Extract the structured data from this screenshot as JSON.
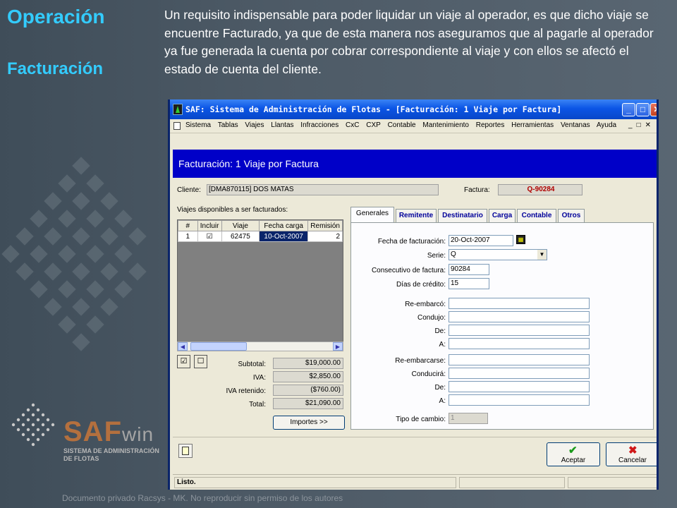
{
  "slide": {
    "title": "Operación",
    "subtitle": "Facturación",
    "body": "Un requisito indispensable para poder liquidar un viaje al operador, es que dicho viaje se encuentre Facturado, ya que de esta manera nos aseguramos que al pagarle al operador ya fue generada la cuenta por cobrar correspondiente al viaje y con ellos se afectó el estado de cuenta del cliente.",
    "logo_brand": "SAF",
    "logo_suffix": "win",
    "logo_tagline": "SISTEMA DE ADMINISTRACIÓN DE FLOTAS",
    "footer": "Documento privado Racsys - MK. No reproducir sin permiso de los autores"
  },
  "window": {
    "title": "SAF: Sistema de Administración de Flotas - [Facturación: 1 Viaje por Factura]",
    "menu": [
      "Sistema",
      "Tablas",
      "Viajes",
      "Llantas",
      "Infracciones",
      "CxC",
      "CXP",
      "Contable",
      "Mantenimiento",
      "Reportes",
      "Herramientas",
      "Ventanas",
      "Ayuda"
    ],
    "form_header": "Facturación: 1 Viaje por Factura",
    "cliente_label": "Cliente:",
    "cliente_value": "[DMA870115] DOS MATAS",
    "factura_label": "Factura:",
    "factura_value": "Q-90284",
    "viajes_label": "Viajes disponibles a ser facturados:",
    "grid": {
      "headers": [
        "#",
        "Incluir",
        "Viaje",
        "Fecha carga",
        "Remisión"
      ],
      "rows": [
        {
          "num": "1",
          "incluir": "☑",
          "viaje": "62475",
          "fecha": "10-Oct-2007",
          "remision": "2"
        }
      ]
    },
    "totals": {
      "subtotal_label": "Subtotal:",
      "subtotal": "$19,000.00",
      "iva_label": "IVA:",
      "iva": "$2,850.00",
      "iva_ret_label": "IVA retenido:",
      "iva_ret": "($760.00)",
      "total_label": "Total:",
      "total": "$21,090.00"
    },
    "importes_button": "Importes >>",
    "tabs": [
      "Generales",
      "Remitente",
      "Destinatario",
      "Carga",
      "Contable",
      "Otros"
    ],
    "generales": {
      "fecha_label": "Fecha de facturación:",
      "fecha": "20-Oct-2007",
      "serie_label": "Serie:",
      "serie": "Q",
      "consecutivo_label": "Consecutivo de factura:",
      "consecutivo": "90284",
      "dias_label": "Días de crédito:",
      "dias": "15",
      "reembarco_label": "Re-embarcó:",
      "condujo_label": "Condujo:",
      "de1_label": "De:",
      "a1_label": "A:",
      "reembarcarse_label": "Re-embarcarse:",
      "conducira_label": "Conducirá:",
      "de2_label": "De:",
      "a2_label": "A:",
      "tipo_cambio_label": "Tipo de cambio:",
      "tipo_cambio": "1"
    },
    "aceptar": "Aceptar",
    "cancelar": "Cancelar",
    "status": "Listo."
  }
}
